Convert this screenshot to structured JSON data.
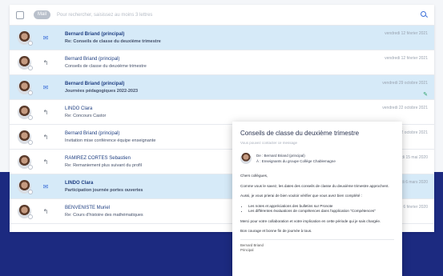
{
  "search": {
    "badge": "Mail",
    "placeholder": "Pour rechercher, saisissez au moins 3 lettres"
  },
  "colors": {
    "accent": "#3b6fd8",
    "selected_row": "#d6eaf8",
    "navy": "#1c2a80"
  },
  "messages": [
    {
      "sender": "Bernard Briand (principal)",
      "subject": "Re: Conseils de classe du deuxième trimestre",
      "date": "vendredi 12 février 2021",
      "icon": "envelope-icon",
      "selected": true,
      "unread": true
    },
    {
      "sender": "Bernard Briand (principal)",
      "subject": "Conseils de classe du deuxième trimestre",
      "date": "vendredi 12 février 2021",
      "icon": "reply-icon",
      "selected": false,
      "unread": false
    },
    {
      "sender": "Bernard Briand (principal)",
      "subject": "Journées pédagogiques 2022-2023",
      "date": "vendredi 29 octobre 2021",
      "icon": "envelope-icon",
      "selected": true,
      "unread": true
    },
    {
      "sender": "LINDO Clara",
      "subject": "Re: Concours Castor",
      "date": "vendredi 22 octobre 2021",
      "icon": "reply-icon",
      "selected": false,
      "unread": false
    },
    {
      "sender": "Bernard Briand (principal)",
      "subject": "Invitation mise conférence équipe enseignante",
      "date": "vendredi 22 octobre 2021",
      "icon": "reply-icon",
      "selected": false,
      "unread": false
    },
    {
      "sender": "RAMIREZ CORTES Sebastien",
      "subject": "Re: Remaniement plus suivant du profil",
      "date": "vendredi 15 mai 2020",
      "icon": "reply-icon",
      "selected": false,
      "unread": false
    },
    {
      "sender": "LINDO Clara",
      "subject": "Participation journée portes ouvertes",
      "date": "vendredi 6 mars 2020",
      "icon": "envelope-icon",
      "selected": true,
      "unread": true
    },
    {
      "sender": "BENVENISTE Muriel",
      "subject": "Re: Cours d'histoire des mathématiques",
      "date": "vendredi 6 février 2020",
      "icon": "reply-icon",
      "selected": false,
      "unread": false
    }
  ],
  "preview": {
    "title": "Conseils de classe du deuxième trimestre",
    "meta": "Vous pouvez contacter ce message",
    "from_line": "De : Bernard Briand (principal)",
    "to_line": "À : Enseignants du groupe Collège Chablemagne",
    "greeting": "Chers collègues,",
    "p1": "Comme vous le savez, les dates des conseils de classe du deuxième trimestre approchent.",
    "p2": "Aussi, je vous prierai de bien vouloir vérifier que vous avez bien complété :",
    "li1": "Les notes et appréciations des bulletins sur Pronote",
    "li2": "Les différentes évaluations de compétences dans l'application \"Compétences\"",
    "p3": "Merci pour votre collaboration et votre implication en cette période qui je sais chargée.",
    "p4": "Bon courage et bonne fin de journée à tous.",
    "sign1": "Bernard Briand",
    "sign2": "Principal"
  }
}
